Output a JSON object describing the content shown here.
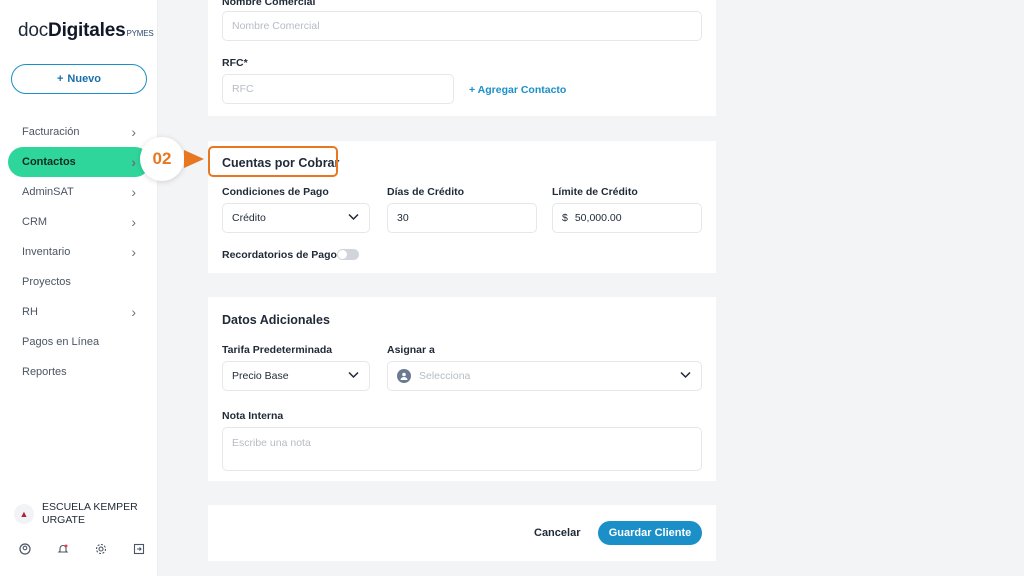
{
  "brand": {
    "part1": "doc",
    "part2": "Digitales",
    "suffix": "PYMES"
  },
  "new_button": {
    "icon": "plus-icon",
    "label": "Nuevo"
  },
  "nav": [
    {
      "label": "Facturación",
      "chevron": true,
      "active": false
    },
    {
      "label": "Contactos",
      "chevron": true,
      "active": true
    },
    {
      "label": "AdminSAT",
      "chevron": true,
      "active": false
    },
    {
      "label": "CRM",
      "chevron": true,
      "active": false
    },
    {
      "label": "Inventario",
      "chevron": true,
      "active": false
    },
    {
      "label": "Proyectos",
      "chevron": false,
      "active": false
    },
    {
      "label": "RH",
      "chevron": true,
      "active": false
    },
    {
      "label": "Pagos en Línea",
      "chevron": false,
      "active": false
    },
    {
      "label": "Reportes",
      "chevron": false,
      "active": false
    }
  ],
  "user": {
    "name": "ESCUELA KEMPER URGATE"
  },
  "bottom_icons": [
    "user-circle-icon",
    "bell-icon",
    "gear-icon",
    "logout-icon"
  ],
  "form": {
    "nombre_comercial": {
      "label": "Nombre Comercial",
      "placeholder": "Nombre Comercial"
    },
    "rfc": {
      "label": "RFC*",
      "placeholder": "RFC"
    },
    "add_contact": "+ Agregar Contacto"
  },
  "step": {
    "number": "02",
    "color": "#e87722"
  },
  "cuentas": {
    "title": "Cuentas por Cobrar",
    "condiciones_label": "Condiciones de Pago",
    "condiciones_value": "Crédito",
    "dias_label": "Días de Crédito",
    "dias_value": "30",
    "limite_label": "Límite de Crédito",
    "limite_currency": "$",
    "limite_value": "50,000.00",
    "recordatorios_label": "Recordatorios de Pago",
    "recordatorios_on": false
  },
  "adicionales": {
    "title": "Datos Adicionales",
    "tarifa_label": "Tarifa Predeterminada",
    "tarifa_value": "Precio Base",
    "asignar_label": "Asignar a",
    "asignar_placeholder": "Selecciona",
    "nota_label": "Nota Interna",
    "nota_placeholder": "Escribe una nota"
  },
  "actions": {
    "cancel": "Cancelar",
    "save": "Guardar Cliente"
  },
  "colors": {
    "accent": "#1a8fc8",
    "active_nav": "#2fd69b",
    "highlight": "#e87722"
  }
}
